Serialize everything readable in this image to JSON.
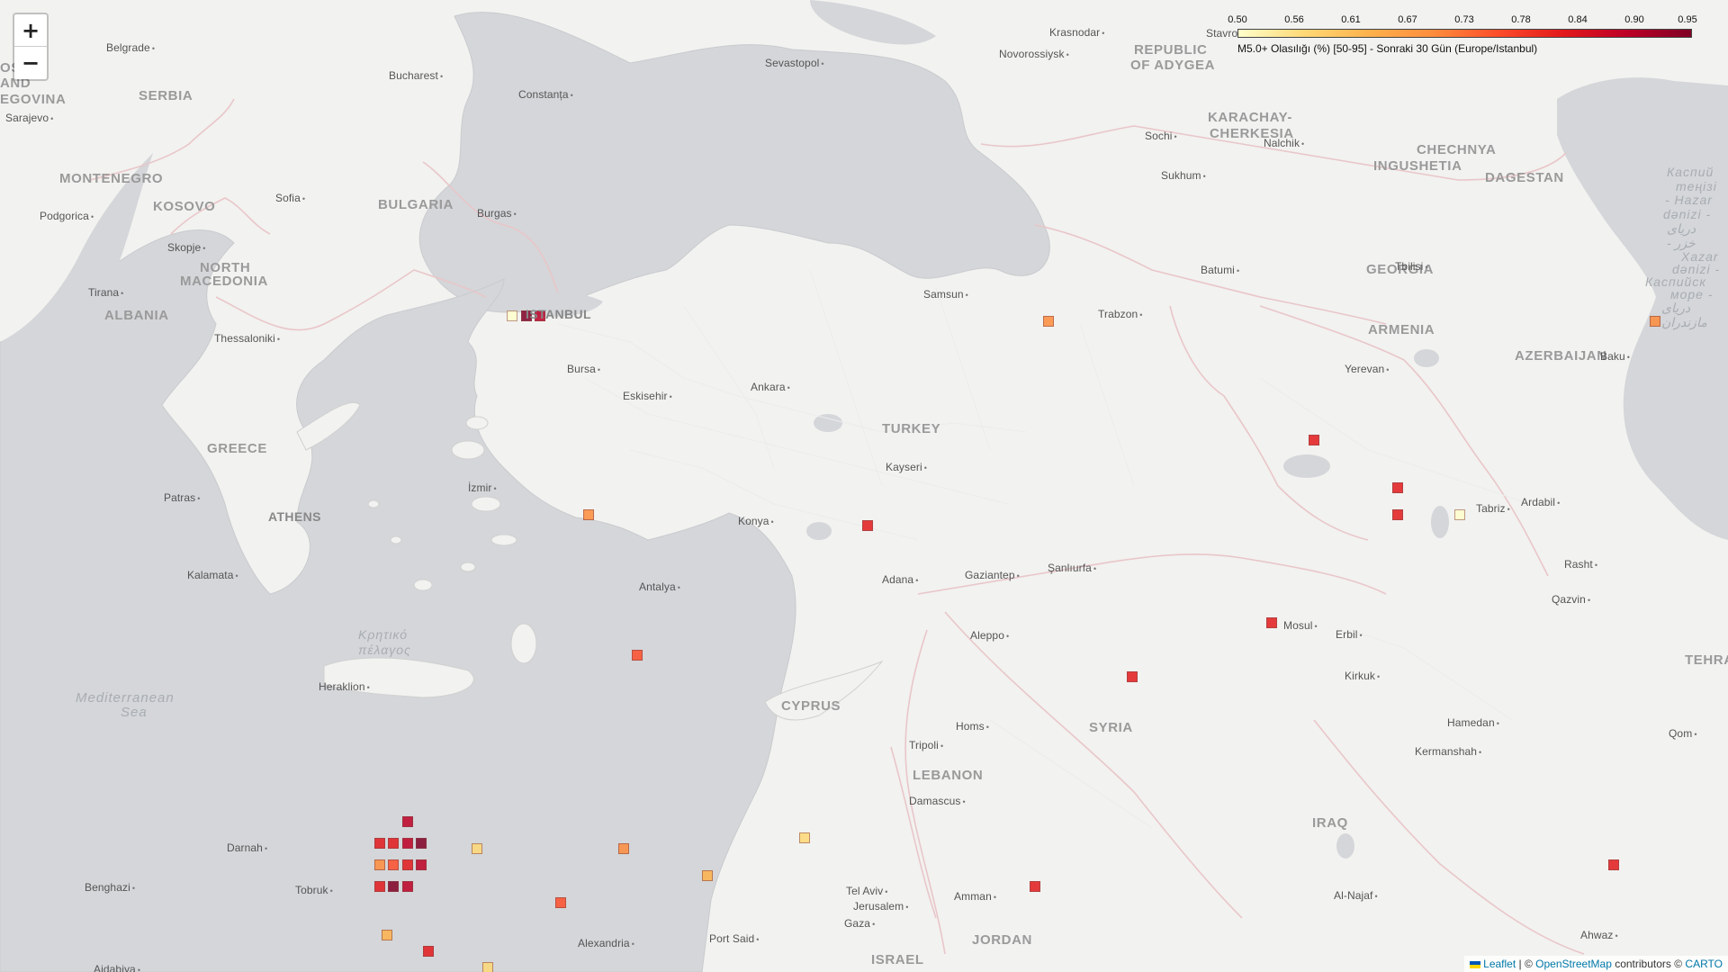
{
  "zoom": {
    "in_label": "+",
    "out_label": "−"
  },
  "legend": {
    "ticks": [
      "0.50",
      "0.56",
      "0.61",
      "0.67",
      "0.73",
      "0.78",
      "0.84",
      "0.90",
      "0.95"
    ],
    "caption": "M5.0+ Olasılığı (%) [50-95] - Sonraki 30 Gün (Europe/Istanbul)",
    "colors": [
      "#ffffcc",
      "#fed976",
      "#feb24c",
      "#fd8d3c",
      "#fc4e2a",
      "#e31a1c",
      "#bd0026",
      "#800026"
    ]
  },
  "attribution": {
    "leaflet": "Leaflet",
    "sep": " | © ",
    "osm": "OpenStreetMap",
    "contributors": " contributors © ",
    "carto": "CARTO"
  },
  "labels": {
    "countries": [
      "SERBIA",
      "MONTENEGRO",
      "KOSOVO",
      "BULGARIA",
      "NORTH",
      "MACEDONIA",
      "ALBANIA",
      "GREECE",
      "TURKEY",
      "REPUBLIC",
      "OF ADYGEA",
      "KARACHAY-",
      "CHERKESIA",
      "CHECHNYA",
      "INGUSHETIA",
      "DAGESTAN",
      "GEORGIA",
      "ARMENIA",
      "AZERBAIJAN",
      "SYRIA",
      "CYPRUS",
      "LEBANON",
      "IRAQ",
      "JORDAN",
      "ISRAEL",
      "OS",
      "AND",
      "EGOVINA"
    ],
    "capitals": [
      "ATHENS",
      "ISTANBUL"
    ],
    "cities": [
      "Belgrade",
      "Bucharest",
      "Constanța",
      "Sevastopol",
      "Novorossiysk",
      "Krasnodar",
      "Stavro",
      "Sarajevo",
      "Sofia",
      "Burgas",
      "Podgorica",
      "Skopje",
      "Tirana",
      "Thessaloniki",
      "Bursa",
      "Eskisehir",
      "Ankara",
      "Samsun",
      "Trabzon",
      "Batumi",
      "Tbilisi",
      "Sochi",
      "Sukhum",
      "Nalchik",
      "Yerevan",
      "Baku",
      "Patras",
      "İzmir",
      "Kayseri",
      "Konya",
      "Kalamata",
      "Antalya",
      "Adana",
      "Gaziantep",
      "Şanlıurfa",
      "Tabriz",
      "Ardabil",
      "Rasht",
      "Qazvin",
      "Mosul",
      "Erbil",
      "Kirkuk",
      "Aleppo",
      "Heraklion",
      "Homs",
      "Tripoli",
      "Damascus",
      "Hamedan",
      "Kermanshah",
      "Qom",
      "Darnah",
      "Benghazi",
      "Tobruk",
      "Alexandria",
      "Port Said",
      "Tel Aviv",
      "Jerusalem",
      "Amman",
      "Gaza",
      "Al-Najaf",
      "Ahwaz",
      "Ajdabiya"
    ],
    "seas": [
      "Mediterranean",
      "Sea",
      "Κρητικό",
      "πέλαγος",
      "Каспий",
      "теңізі",
      "- Hazar",
      "dənizi -",
      "دریای",
      "- خزر",
      "Xazar",
      "dənizi -",
      "Каспийск",
      "море -",
      "دریای",
      "مازندران"
    ],
    "partial": [
      "TEHRA"
    ]
  },
  "cells": [
    {
      "lat": 41.05,
      "lon": 28.4,
      "p": 0.52
    },
    {
      "lat": 41.05,
      "lon": 28.6,
      "p": 0.94
    },
    {
      "lat": 41.05,
      "lon": 28.8,
      "p": 0.9
    },
    {
      "lat": 41.0,
      "lon": 36.1,
      "p": 0.7
    },
    {
      "lat": 41.0,
      "lon": 44.8,
      "p": 0.72
    },
    {
      "lat": 39.2,
      "lon": 29.5,
      "p": 0.72
    },
    {
      "lat": 39.1,
      "lon": 33.5,
      "p": 0.8
    },
    {
      "lat": 39.9,
      "lon": 39.9,
      "p": 0.8
    },
    {
      "lat": 39.45,
      "lon": 41.1,
      "p": 0.82
    },
    {
      "lat": 39.2,
      "lon": 41.1,
      "p": 0.82
    },
    {
      "lat": 39.2,
      "lon": 42.0,
      "p": 0.52
    },
    {
      "lat": 37.9,
      "lon": 30.2,
      "p": 0.78
    },
    {
      "lat": 38.2,
      "lon": 39.3,
      "p": 0.8
    },
    {
      "lat": 37.7,
      "lon": 37.3,
      "p": 0.82
    },
    {
      "lat": 35.95,
      "lon": 44.2,
      "p": 0.82
    },
    {
      "lat": 36.35,
      "lon": 26.9,
      "p": 0.88
    },
    {
      "lat": 36.15,
      "lon": 26.5,
      "p": 0.8
    },
    {
      "lat": 36.15,
      "lon": 26.7,
      "p": 0.84
    },
    {
      "lat": 36.15,
      "lon": 26.9,
      "p": 0.86
    },
    {
      "lat": 36.15,
      "lon": 27.1,
      "p": 0.92
    },
    {
      "lat": 35.95,
      "lon": 26.5,
      "p": 0.7
    },
    {
      "lat": 35.95,
      "lon": 26.7,
      "p": 0.78
    },
    {
      "lat": 35.95,
      "lon": 26.9,
      "p": 0.82
    },
    {
      "lat": 35.95,
      "lon": 27.1,
      "p": 0.9
    },
    {
      "lat": 35.75,
      "lon": 26.5,
      "p": 0.82
    },
    {
      "lat": 35.75,
      "lon": 26.7,
      "p": 0.93
    },
    {
      "lat": 35.75,
      "lon": 26.9,
      "p": 0.86
    },
    {
      "lat": 36.1,
      "lon": 27.9,
      "p": 0.55
    },
    {
      "lat": 36.1,
      "lon": 30.0,
      "p": 0.7
    },
    {
      "lat": 36.2,
      "lon": 32.6,
      "p": 0.54
    },
    {
      "lat": 35.85,
      "lon": 31.2,
      "p": 0.62
    },
    {
      "lat": 35.6,
      "lon": 29.1,
      "p": 0.74
    },
    {
      "lat": 35.75,
      "lon": 35.9,
      "p": 0.8
    },
    {
      "lat": 35.3,
      "lon": 26.6,
      "p": 0.6
    },
    {
      "lat": 35.15,
      "lon": 27.2,
      "p": 0.82
    },
    {
      "lat": 35.0,
      "lon": 28.05,
      "p": 0.56
    },
    {
      "lat": 34.85,
      "lon": 28.05,
      "p": 0.58
    }
  ]
}
